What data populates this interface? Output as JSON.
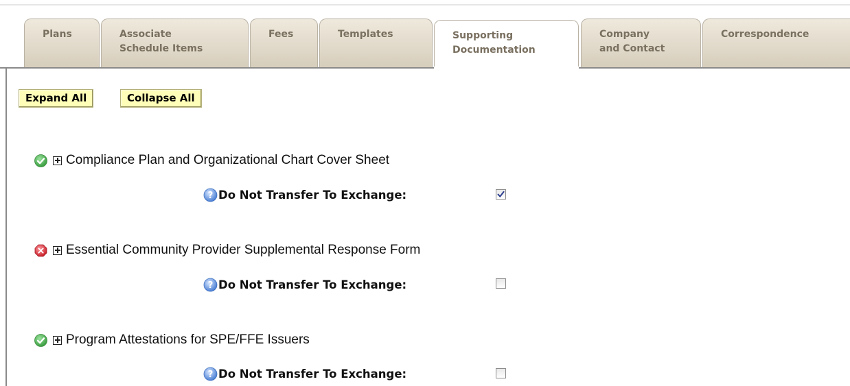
{
  "tabs": [
    {
      "label_line1": "Plans",
      "label_line2": "",
      "active": false
    },
    {
      "label_line1": "Associate",
      "label_line2": "Schedule Items",
      "active": false
    },
    {
      "label_line1": "Fees",
      "label_line2": "",
      "active": false
    },
    {
      "label_line1": "Templates",
      "label_line2": "",
      "active": false
    },
    {
      "label_line1": "Supporting",
      "label_line2": "Documentation",
      "active": true
    },
    {
      "label_line1": "Company",
      "label_line2": "and Contact",
      "active": false
    },
    {
      "label_line1": "Correspondence",
      "label_line2": "",
      "active": false
    }
  ],
  "toolbar": {
    "expand_all": "Expand All",
    "collapse_all": "Collapse All"
  },
  "colors": {
    "status_complete": "#4caf50",
    "status_error": "#d9363e",
    "button_bg": "#fffeb8"
  },
  "documents": [
    {
      "title": "Compliance Plan and Organizational Chart Cover Sheet",
      "status": "complete",
      "status_icon": "check-circle-icon",
      "transfer_label": "Do Not Transfer To Exchange:",
      "do_not_transfer": true
    },
    {
      "title": "Essential Community Provider Supplemental Response Form",
      "status": "error",
      "status_icon": "x-circle-icon",
      "transfer_label": "Do Not Transfer To Exchange:",
      "do_not_transfer": false
    },
    {
      "title": "Program Attestations for SPE/FFE Issuers",
      "status": "complete",
      "status_icon": "check-circle-icon",
      "transfer_label": "Do Not Transfer To Exchange:",
      "do_not_transfer": false
    }
  ]
}
